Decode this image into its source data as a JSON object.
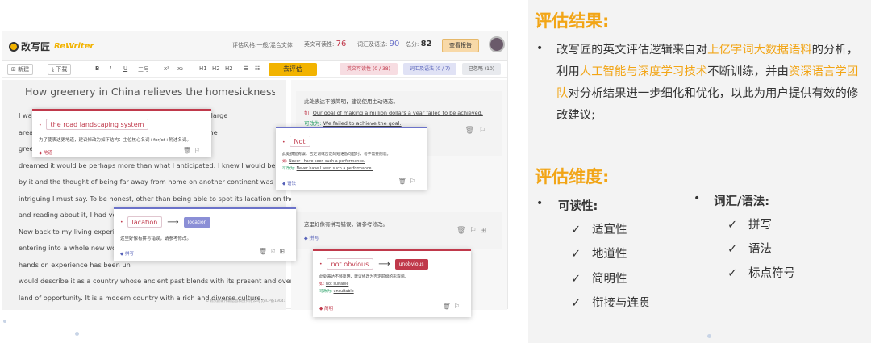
{
  "app": {
    "brand": "改写匠",
    "brand_sub": "ReWriter",
    "style_label": "评估风格:",
    "style_value": "一般/混合文体",
    "readability_label": "英文可读性:",
    "readability_value": "76",
    "vocab_label": "词汇及语法:",
    "vocab_value": "90",
    "total_label": "总分:",
    "total_value": "82",
    "report_button": "查看报告"
  },
  "toolbar": {
    "new": "新建",
    "download": "下载",
    "bold": "B",
    "italic": "I",
    "underline": "U",
    "font": "三号",
    "sup": "x²",
    "sub": "x₂",
    "h1": "H1",
    "h2": "H2",
    "h2b": "H2",
    "evaluate": "去评估",
    "tab_readability": "英文可读性 (0 / 38)",
    "tab_vocab": "词汇及语法 (0 / 7)",
    "tab_ignored": "已忽略 (10)"
  },
  "doc": {
    "title": "How greenery in China relieves the homesickness of a",
    "lines": [
      "I was                                                          e owning to the large",
      "area                                                           this name and the",
      "green                                                          I imagined and",
      "dreamed it would be perhaps more than what I anticipated. I knew I would be impressed",
      "by it and the thought of being far away from home on another continent was quite",
      "intriguing I must say. To be honest, other than being able to spot its lacation on the map",
      "and reading about it, I had very little knowledge about China.",
      "Now back to my living experience",
      "entering into a whole new world",
      "hands on experience has been un",
      "would describe it as a country whose ancient past blends with its present and overall a",
      "land of opportunity. It is a modern country with a rich and diverse culture."
    ]
  },
  "side_cards": {
    "c1_note": "此处表达不够简明，建议使用主动语态。",
    "c1_orig_label": "如:",
    "c1_orig": "Our goal of making a million dollars a year failed to be achieved.",
    "c1_fix_label": "可改为:",
    "c1_fix": "We failed to achieve the goal.",
    "c2_note": "这里好像有拼写错误，请参考修改。",
    "c2_cat": "拼写"
  },
  "pop1": {
    "chip": "the road landscaping system",
    "note": "为了使表达更地道，建议修改为如下结构：主位核心名词+for/of+附述名词。",
    "cat": "地道"
  },
  "pop2": {
    "chip": "Not",
    "note": "此处撰配有误，否定词或否定的短语放句首时，句子需要倒装。",
    "orig_label": "如:",
    "orig": "Never I have seen such a performance.",
    "fix_label": "可改为:",
    "fix": "Never have I seen such a performance.",
    "cat": "语法"
  },
  "pop3": {
    "chip": "lacation",
    "suggest": "location",
    "note": "这里好像有拼写错误，请参考修改。",
    "cat": "拼写"
  },
  "pop4": {
    "chip": "not obvious",
    "suggest": "unobvious",
    "note": "此处表达不够简明，建议修改为否定前缀的形容词。",
    "orig_label": "如:",
    "orig": "not suitable",
    "fix_label": "可改为:",
    "fix": "unsuitable",
    "cat": "简明"
  },
  "footer": "©南京颜录伟新信息科技有限公司 苏ICP备19041",
  "panel": {
    "result_title": "评估结果:",
    "result_p1": "改写匠的英文评估逻辑来自对",
    "result_hl1": "上亿字词大数据语料",
    "result_p2": "的分析，利用",
    "result_hl2": "人工智能与深度学习技术",
    "result_p3": "不断训练，并由",
    "result_hl3": "资深语言学团队",
    "result_p4": "对分析结果进一步细化和优化，以此为用户提供有效的修改建议;",
    "dim_title": "评估维度:",
    "readability_head": "可读性:",
    "readability_items": [
      "适宜性",
      "地道性",
      "简明性",
      "衔接与连贯"
    ],
    "vocab_head": "词汇/语法:",
    "vocab_items": [
      "拼写",
      "语法",
      "标点符号"
    ],
    "check": "✓",
    "bullet": "•"
  }
}
